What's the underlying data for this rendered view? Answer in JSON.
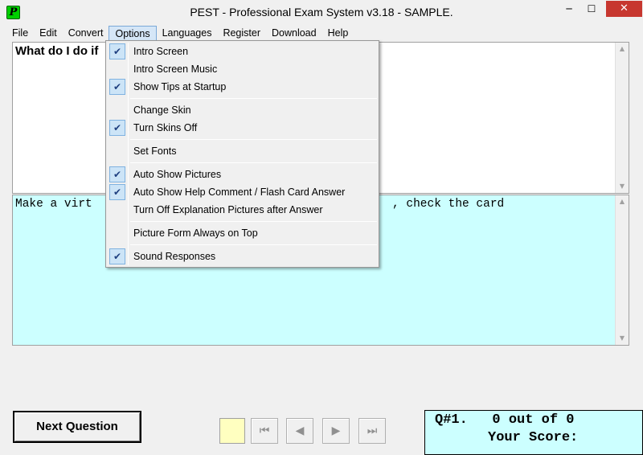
{
  "window": {
    "title": "PEST - Professional Exam System v3.18 - SAMPLE.",
    "close_glyph": "✕",
    "minimize_glyph": "─",
    "maximize_glyph": "☐"
  },
  "menubar": [
    "File",
    "Edit",
    "Convert",
    "Options",
    "Languages",
    "Register",
    "Download",
    "Help"
  ],
  "options_menu": {
    "intro_screen": "Intro Screen",
    "intro_screen_music": "Intro Screen Music",
    "show_tips": "Show Tips at Startup",
    "change_skin": "Change Skin",
    "turn_skins_off": "Turn Skins Off",
    "set_fonts": "Set Fonts",
    "auto_show_pictures": "Auto Show Pictures",
    "auto_show_help": "Auto Show Help Comment / Flash Card Answer",
    "turn_off_expl": "Turn Off Explanation Pictures after Answer",
    "picture_form": "Picture Form Always on Top",
    "sound_responses": "Sound Responses",
    "check_glyph": "✔"
  },
  "question": {
    "text": "What do I do if"
  },
  "answer": {
    "left": "Make a virt",
    "right": ", check the card"
  },
  "controls": {
    "next_question": "Next Question",
    "first_glyph": "⏮",
    "prev_glyph": "◀",
    "next_glyph": "▶",
    "last_glyph": "⏭"
  },
  "score": {
    "line1": "Q#1.   0 out of 0",
    "line2": "Your Score:"
  },
  "colors": {
    "answer_bg": "#ccffff",
    "close_button": "#c7372f",
    "menu_highlight": "#d5e6f7"
  },
  "icons": {
    "scroll_up": "▲",
    "scroll_down": "▼",
    "app": "P"
  }
}
